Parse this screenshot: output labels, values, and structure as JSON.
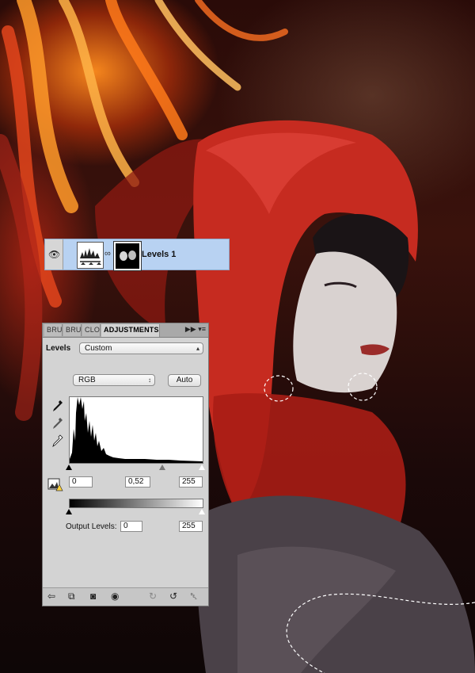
{
  "layer": {
    "name": "Levels 1",
    "visibility_icon": "eye-icon",
    "link_icon": "chain-link-icon"
  },
  "panel": {
    "tabs": [
      "BRU",
      "BRU",
      "CLO",
      "ADJUSTMENTS"
    ],
    "active_tab": "ADJUSTMENTS",
    "title": "Levels",
    "preset": "Custom",
    "channel": "RGB",
    "auto_label": "Auto",
    "input_levels": {
      "black": "0",
      "gamma": "0,52",
      "white": "255"
    },
    "output_label": "Output Levels:",
    "output_levels": {
      "black": "0",
      "white": "255"
    },
    "bottom_icons": [
      "back-arrow-icon",
      "clip-to-layer-icon",
      "mask-icon",
      "eye-icon",
      "previous-state-icon",
      "reset-icon",
      "trash-icon"
    ]
  },
  "colors": {
    "layer_highlight": "#b8d2f2",
    "panel_bg": "#d3d3d3",
    "hood_red": "#c62b20"
  }
}
